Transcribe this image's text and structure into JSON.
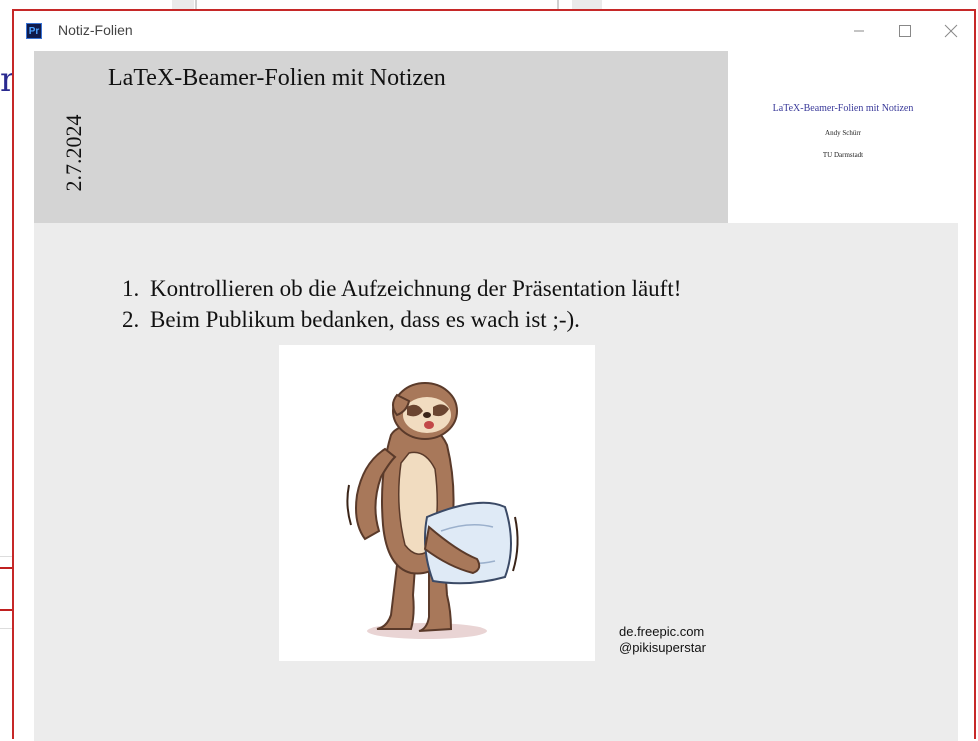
{
  "background": {
    "partial_text": "n"
  },
  "window": {
    "title": "Notiz-Folien",
    "app_icon_label": "Pr",
    "controls": {
      "minimize_icon": "minimize-icon",
      "maximize_icon": "maximize-icon",
      "close_icon": "close-icon"
    },
    "accent_border": "#c62828"
  },
  "slide": {
    "date": "2.7.2024",
    "title": "LaTeX-Beamer-Folien mit Notizen",
    "thumbnail": {
      "title": "LaTeX-Beamer-Folien mit Notizen",
      "author": "Andy Schürr",
      "institute": "TU Darmstadt"
    }
  },
  "notes": {
    "items": [
      {
        "num": "1.",
        "text": "Kontrollieren ob die Aufzeichnung der Präsentation läuft!"
      },
      {
        "num": "2.",
        "text": "Beim Publikum bedanken, dass es wach ist ;-)."
      }
    ],
    "image_icon": "sloth-with-pillow-illustration",
    "credit_line1": "de.freepic.com",
    "credit_line2": "@pikisuperstar"
  }
}
